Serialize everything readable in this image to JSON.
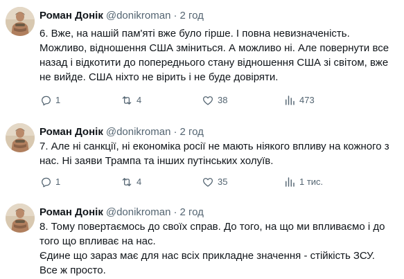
{
  "tweets": [
    {
      "author_name": "Роман Донік",
      "handle": "@donikroman",
      "separator": "·",
      "time": "2 год",
      "text": "6. Вже, на нашій пам'яті вже було гірше. І повна невизначеність.\nМожливо, відношення США зміниться. А можливо ні.  Але повернути все\nназад і відкотити до попереднього стану відношення США зі світом, вже\nне вийде. США ніхто не вірить і не буде довіряти.",
      "replies": "1",
      "reposts": "4",
      "likes": "38",
      "views": "473"
    },
    {
      "author_name": "Роман Донік",
      "handle": "@donikroman",
      "separator": "·",
      "time": "2 год",
      "text": "7. Але ні санкції, ні економіка росії не мають ніякого впливу на кожного з\nнас. Ні заяви Трампа та інших путінських холуїв.",
      "replies": "1",
      "reposts": "4",
      "likes": "35",
      "views": "1 тис."
    },
    {
      "author_name": "Роман Донік",
      "handle": "@donikroman",
      "separator": "·",
      "time": "2 год",
      "text": "8. Тому повертаємось до своїх справ. До того, на що ми впливаємо і до\nтого що впливає на нас.\nЄдине що зараз має для нас всіх прикладне значення - стійкість ЗСУ.\nВсе ж просто."
    }
  ],
  "icons": {
    "reply": "reply-icon",
    "repost": "repost-icon",
    "like": "like-icon",
    "views": "views-icon"
  },
  "colors": {
    "text": "#0f1419",
    "secondary": "#536471",
    "background": "#ffffff"
  }
}
